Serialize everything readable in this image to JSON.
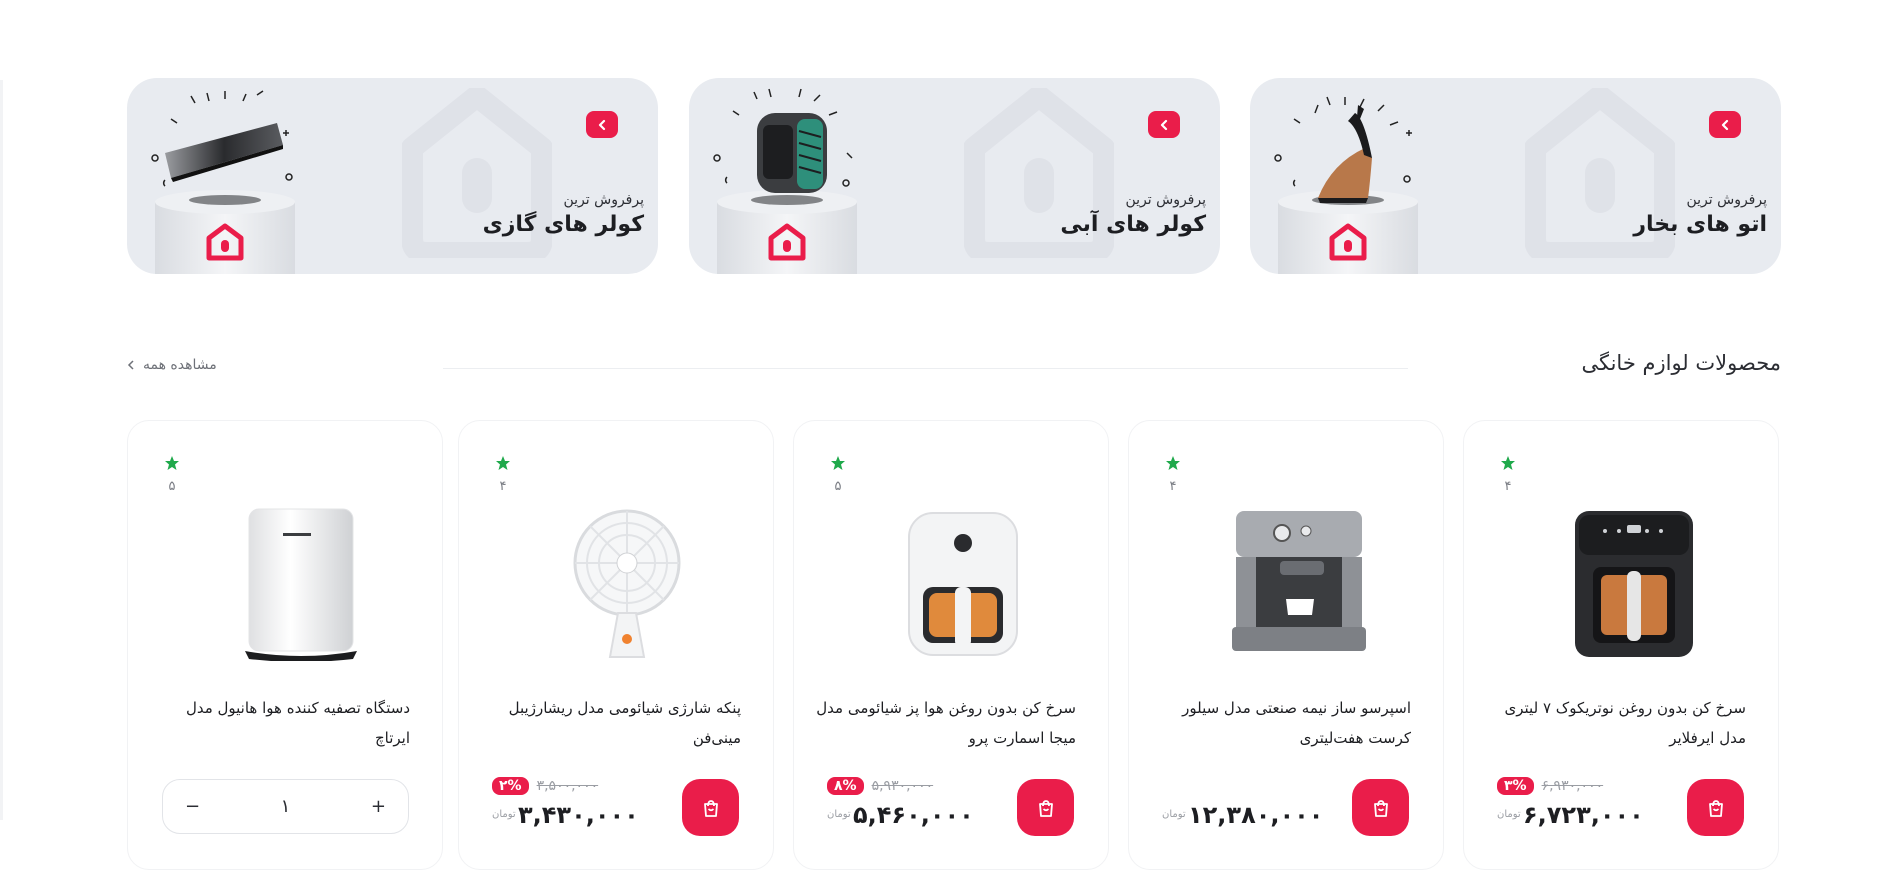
{
  "banners": [
    {
      "kicker": "پرفروش ترین",
      "title": "اتو های بخار",
      "icon": "steam-iron-icon"
    },
    {
      "kicker": "پرفروش ترین",
      "title": "کولر های آبی",
      "icon": "evaporative-cooler-icon"
    },
    {
      "kicker": "پرفروش ترین",
      "title": "کولر های گازی",
      "icon": "air-conditioner-icon"
    }
  ],
  "section": {
    "title": "محصولات لوازم خانگی",
    "see_all": "مشاهده همه"
  },
  "products": [
    {
      "name": "سرخ کن بدون روغن نوتریکوک ۷ لیتری مدل ایرفلایر",
      "rating": "۴",
      "discount": "۳",
      "old_price": "۶,۹۳۰,۰۰۰",
      "price": "۶,۷۲۳,۰۰۰",
      "currency": "تومان"
    },
    {
      "name": "اسپرسو ساز نیمه صنعتی مدل سیلور کرست هفت‌لیتری",
      "rating": "۴",
      "discount": "",
      "old_price": "",
      "price": "۱۲,۳۸۰,۰۰۰",
      "currency": "تومان"
    },
    {
      "name": "سرخ کن بدون روغن هوا پز شیائومی مدل میجا اسمارت پرو",
      "rating": "۵",
      "discount": "۸",
      "old_price": "۵,۹۳۰,۰۰۰",
      "price": "۵,۴۶۰,۰۰۰",
      "currency": "تومان"
    },
    {
      "name": "پنکه شارژی شیائومی مدل ریشارژیبل مینی‌فن",
      "rating": "۴",
      "discount": "۲",
      "old_price": "۳,۵۰۰,۰۰۰",
      "price": "۳,۴۳۰,۰۰۰",
      "currency": "تومان"
    },
    {
      "name": "دستگاه تصفیه کننده هوا هانیول مدل ایرتاچ",
      "rating": "۵",
      "qty": "۱",
      "minus": "−",
      "plus": "+"
    }
  ],
  "colors": {
    "accent": "#ea1d4a",
    "star": "#1fa94b",
    "banner_bg": "#e8ebf0"
  }
}
